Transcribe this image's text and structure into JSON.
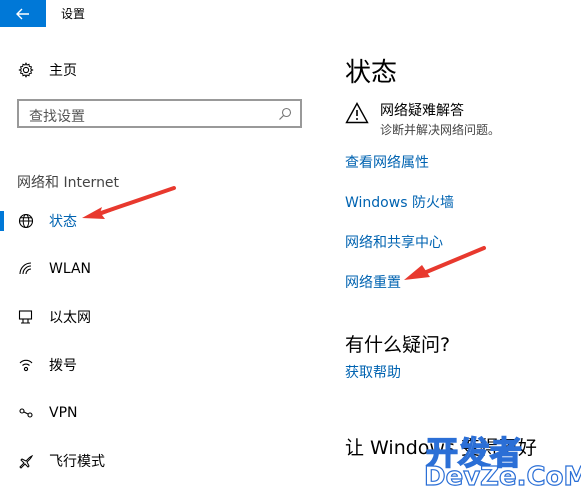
{
  "window": {
    "title": "设置"
  },
  "sidebar": {
    "home_label": "主页",
    "search_placeholder": "查找设置",
    "group_label": "网络和 Internet",
    "items": [
      {
        "label": "状态",
        "icon": "globe-icon",
        "selected": true
      },
      {
        "label": "WLAN",
        "icon": "wifi-icon"
      },
      {
        "label": "以太网",
        "icon": "ethernet-icon"
      },
      {
        "label": "拨号",
        "icon": "dialup-icon"
      },
      {
        "label": "VPN",
        "icon": "vpn-icon"
      },
      {
        "label": "飞行模式",
        "icon": "airplane-icon"
      }
    ]
  },
  "main": {
    "title": "状态",
    "troubleshooter": {
      "title": "网络疑难解答",
      "desc": "诊断并解决网络问题。"
    },
    "links": [
      "查看网络属性",
      "Windows 防火墙",
      "网络和共享中心",
      "网络重置"
    ],
    "questions_title": "有什么疑问?",
    "help_link": "获取帮助",
    "better_title": "让 Windows 变得更好"
  },
  "watermark": {
    "line1": "开发者",
    "line2": "DevZe.CoM"
  },
  "colors": {
    "accent": "#0078d7",
    "link": "#0063b1",
    "arrow": "#e8392e"
  }
}
